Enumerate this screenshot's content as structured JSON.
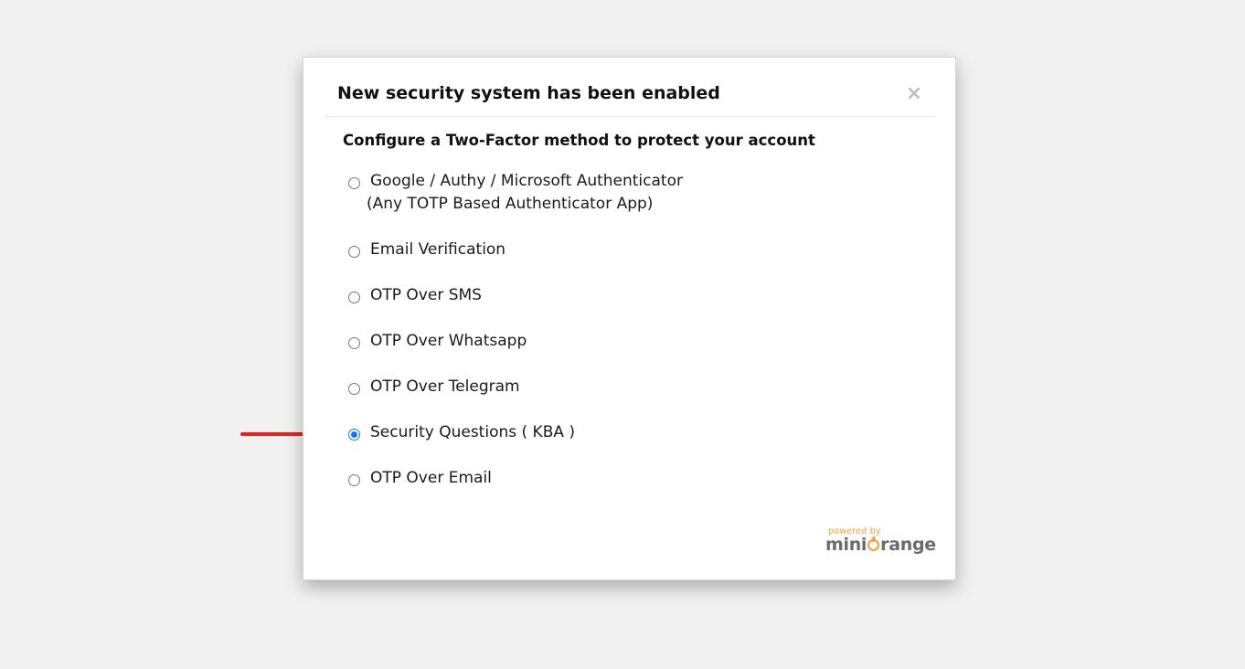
{
  "modal": {
    "title": "New security system has been enabled",
    "close_label": "×",
    "subtitle": "Configure a Two-Factor method to protect your account"
  },
  "options": [
    {
      "label": "Google / Authy / Microsoft Authenticator",
      "sublabel": "(Any TOTP Based Authenticator App)",
      "selected": false
    },
    {
      "label": "Email Verification",
      "selected": false
    },
    {
      "label": "OTP Over SMS",
      "selected": false
    },
    {
      "label": "OTP Over Whatsapp",
      "selected": false
    },
    {
      "label": "OTP Over Telegram",
      "selected": false
    },
    {
      "label": "Security Questions ( KBA )",
      "selected": true
    },
    {
      "label": "OTP Over Email",
      "selected": false
    }
  ],
  "branding": {
    "powered_by": "powered by",
    "name_prefix": "mini",
    "name_suffix": "range"
  },
  "colors": {
    "accent": "#1a73e8",
    "arrow": "#e8201e",
    "brand_orange": "#f39c3d",
    "background": "#f1f1f1"
  },
  "icons": {
    "arrow": "red-arrow-icon",
    "close": "close-icon"
  }
}
